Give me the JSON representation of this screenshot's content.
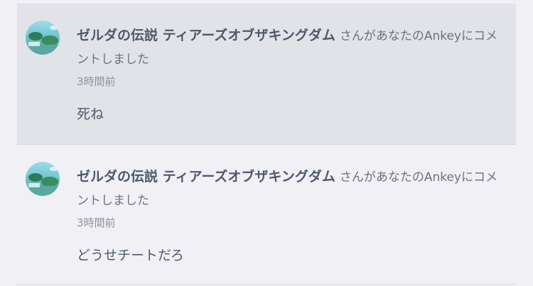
{
  "notifications": [
    {
      "user_name": "ゼルダの伝説 ティアーズオブザキングダム",
      "action_text": "さんがあなたのAnkeyにコメントしました",
      "time": "3時間前",
      "comment": "死ね",
      "avatar_icon": "game-cover-avatar-icon"
    },
    {
      "user_name": "ゼルダの伝説 ティアーズオブザキングダム",
      "action_text": "さんがあなたのAnkeyにコメントしました",
      "time": "3時間前",
      "comment": "どうせチートだろ",
      "avatar_icon": "game-cover-avatar-icon"
    }
  ],
  "colors": {
    "background": "#f0f0f5",
    "highlight_row": "#e1e3e8",
    "name_text": "#4f586a",
    "secondary_text": "#6b7280",
    "time_text": "#8d939e",
    "divider": "#d6d8de"
  }
}
